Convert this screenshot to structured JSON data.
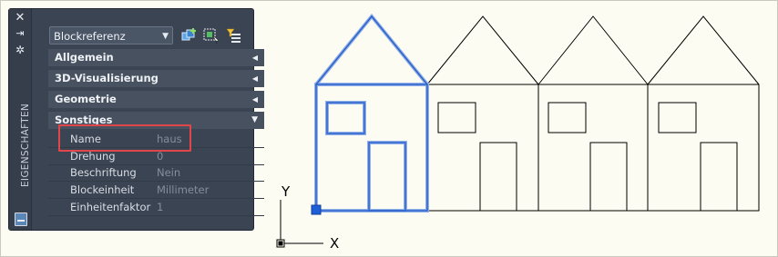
{
  "palette": {
    "vertical_title": "EIGENSCHAFTEN",
    "strip_icons": [
      "close-icon",
      "pin-icon",
      "settings-icon"
    ],
    "object_selector": "Blockreferenz",
    "toolbar_icons": [
      "toggle-pickadd-icon",
      "select-objects-icon",
      "quick-select-icon"
    ],
    "categories": {
      "general": "Allgemein",
      "vis3d": "3D-Visualisierung",
      "geometry": "Geometrie",
      "misc": "Sonstiges"
    },
    "properties": [
      {
        "key": "Name",
        "value": "haus"
      },
      {
        "key": "Drehung",
        "value": "0"
      },
      {
        "key": "Beschriftung",
        "value": "Nein"
      },
      {
        "key": "Blockeinheit",
        "value": "Millimeter"
      },
      {
        "key": "Einheitenfaktor",
        "value": "1"
      }
    ]
  },
  "canvas": {
    "ucs_x_label": "X",
    "ucs_y_label": "Y",
    "selected_color": "#2f62c9",
    "line_color": "#000000",
    "highlight_color": "#e2454a"
  }
}
